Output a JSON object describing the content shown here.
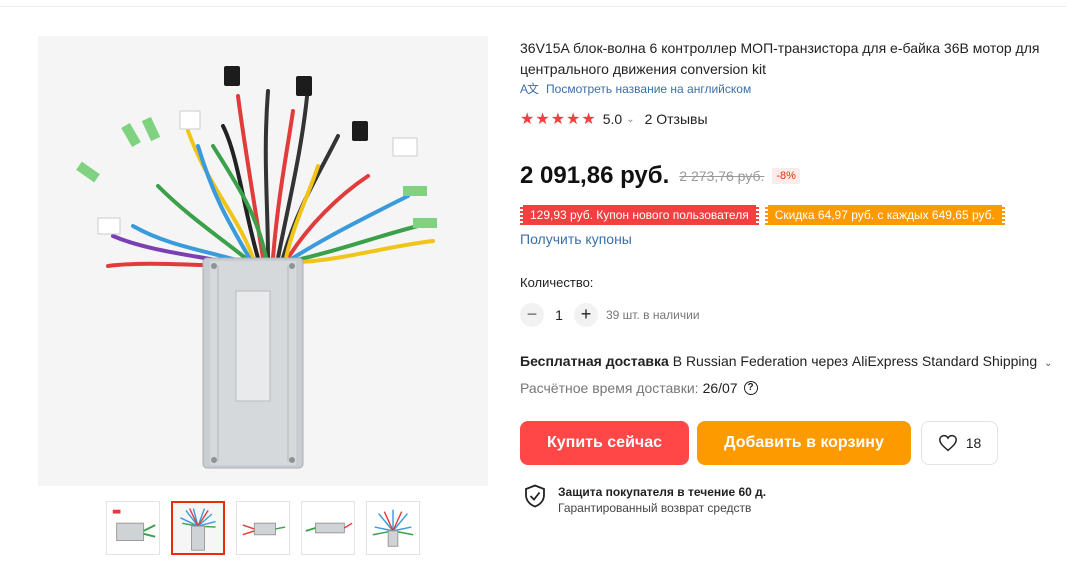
{
  "product": {
    "title": "36V15A блок-волна 6 контроллер МОП-транзистора для e-байка 36В мотор для центрального движения conversion kit",
    "translate_link": "Посмотреть название на английском",
    "translate_icon": "A文",
    "rating_stars": "★★★★★",
    "rating_value": "5.0",
    "rating_caret": "⌄",
    "reviews": "2 Отзывы"
  },
  "pricing": {
    "price": "2 091,86 руб.",
    "old_price": "2 273,76 руб.",
    "discount": "-8%",
    "coupon_new_user": "129,93 руб. Купон нового пользователя",
    "coupon_discount": "Скидка 64,97 руб. с каждых 649,65 руб.",
    "get_coupons": "Получить купоны",
    "colors": {
      "coupon_red": "#f23f3f",
      "coupon_orange": "#fd9a00"
    }
  },
  "quantity": {
    "label": "Количество:",
    "minus": "−",
    "value": "1",
    "plus": "+",
    "stock": "39 шт. в наличии"
  },
  "shipping": {
    "free_label": "Бесплатная доставка",
    "details": "В Russian Federation через AliExpress Standard Shipping",
    "caret": "⌄",
    "eta_label": "Расчётное время доставки:",
    "eta_date": "26/07",
    "help_icon": "?"
  },
  "actions": {
    "buy_now": "Купить сейчас",
    "add_to_cart": "Добавить в корзину",
    "wishlist_count": "18",
    "colors": {
      "buy": "#ff4747",
      "cart": "#fd9a00"
    }
  },
  "protection": {
    "title": "Защита покупателя в течение 60 д.",
    "subtitle": "Гарантированный возврат средств"
  },
  "gallery": {
    "thumbnails": [
      {
        "name": "thumbnail-1",
        "active": false
      },
      {
        "name": "thumbnail-2",
        "active": true
      },
      {
        "name": "thumbnail-3",
        "active": false
      },
      {
        "name": "thumbnail-4",
        "active": false
      },
      {
        "name": "thumbnail-5",
        "active": false
      }
    ]
  }
}
